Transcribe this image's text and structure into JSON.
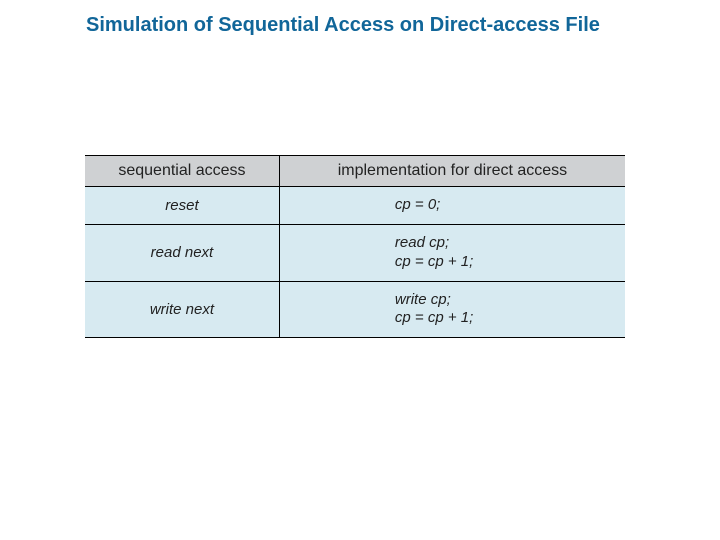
{
  "title": "Simulation of Sequential Access on Direct-access File",
  "table": {
    "headers": {
      "col1": "sequential access",
      "col2": "implementation for direct access"
    },
    "rows": [
      {
        "op": "reset",
        "impl_html": "<span style=\"font-style:italic\">cp</span> = 0;"
      },
      {
        "op": "read next",
        "impl_html": "<span style=\"font-style:italic\">read cp</span>;<br><span style=\"font-style:italic\">cp</span> = <span style=\"font-style:italic\">cp</span> + 1;"
      },
      {
        "op": "write next",
        "impl_html": "<span style=\"font-style:italic\">write cp</span>;<br><span style=\"font-style:italic\">cp</span> = <span style=\"font-style:italic\">cp</span> + 1;"
      }
    ]
  }
}
